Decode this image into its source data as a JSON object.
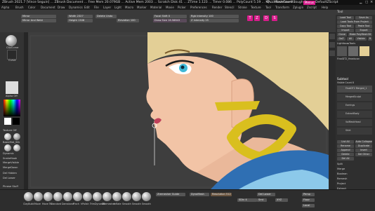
{
  "titlebar": {
    "title": "ZBrush 2021.7 [Vince Seguin] ... ZBrush Document ... Free Mem 20.079GB ... Active Mem 2003 ... Scratch Disk 41 ... ZTime 1.123 ... Timer 0.086 ... PolyCount 5.19 ... KP ... MeshCount 1",
    "quicksave": "QuickSave",
    "see_through": "See-through 0",
    "menus": "Menus",
    "default_zscript": "DefaultZScript"
  },
  "menubar": [
    "Alpha",
    "Brush",
    "Color",
    "Document",
    "Draw",
    "Dynamics",
    "Edit",
    "File",
    "Layer",
    "Light",
    "Macro",
    "Marker",
    "Material",
    "Movie",
    "Picker",
    "Preferences",
    "Render",
    "Stencil",
    "Stroke",
    "Texture",
    "Tool",
    "Transform",
    "Zplugin",
    "Zscript",
    "Help"
  ],
  "topshelf": {
    "mirror": "Mirror",
    "mirror_weld": "Mirror And Weld",
    "width_label": "Width 2327",
    "height_label": "Height 1308",
    "delete_undo": "Delete Undo",
    "polycount_field": "Elevation 100",
    "focal_label": "Focal Shift 0",
    "draw_size": "Draw Size 16.58843",
    "rgb_label": "Rgb Intensity 100",
    "z_intensity": "Z Intensity 25",
    "buttons": [
      "T",
      "Z",
      "D",
      "S"
    ]
  },
  "leftshelf": {
    "tool1": "ClipCurve",
    "tool2": "Curve",
    "alpha_label": "Alpha Off",
    "texture_label": "Texture Off",
    "material1": "MatCap Gray",
    "items": [
      "BasicMat_Silk",
      "ReflectedMap",
      "Dynamic",
      "SnakeHook",
      "MergeVisible",
      "MergeDown",
      "Del Hidden",
      "Del Lower",
      "Phrase Stuff"
    ]
  },
  "rightpanel": {
    "tool_title": "Tool",
    "buttons": [
      "Load Tool",
      "Save As",
      "Load Tools From Project",
      "Copy Tool",
      "Paste Tool",
      "Import",
      "Export",
      "Clone",
      "Make PolyMesh3D",
      "GoZ",
      "All",
      "Visible",
      "R"
    ],
    "lightbox": "Lightbox▸Tools",
    "model_name": "FinalDT2_Headscan",
    "subtool_label": "Subtool",
    "subtools": [
      "Visible Count 8",
      "FinalDT2 Merged_1",
      "MergedSculpt",
      "Earrings",
      "ExtractBody",
      "VolMeshHead",
      "Shirt"
    ],
    "actions": [
      "List All",
      "Auto Collapse",
      "Rename",
      "Duplicate",
      "Append",
      "Insert",
      "Delete",
      "Del Other",
      "Del All",
      "Split",
      "Merge",
      "Boolean",
      "Remesh",
      "Project",
      "Extract"
    ]
  },
  "bottombar": {
    "brushes": [
      "ClayBuild",
      "Move",
      "Move Tri",
      "Standard",
      "Damstand",
      "Pinch",
      "hPolish",
      "TrimDynamic",
      "ZRemesher",
      "Inflate",
      "Smooth",
      "Smooth",
      "Smooth"
    ],
    "persp": "Persp",
    "floor": "Floor",
    "local": "Local",
    "xyz": "XYZ",
    "dynamesh": "DynaMesh",
    "resolution": "Resolution 512",
    "zremesher_label": "Zremesher Guide",
    "del_lower": "Del Lower",
    "smt": "Smt",
    "spi": "SDiv 4"
  },
  "colors": {
    "accent": "#d81b8b",
    "skin": "#f2c4a6",
    "hair": "#e6d29a",
    "eye": "#3fb8d6",
    "earring": "#d9bf1e",
    "shirt_blue": "#2f6fb3",
    "shirt_light": "#8cc9ea"
  }
}
